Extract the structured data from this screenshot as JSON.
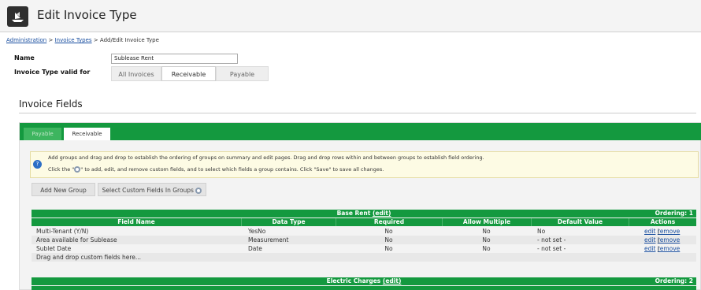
{
  "header": {
    "title": "Edit Invoice Type",
    "app_icon": "ship-icon"
  },
  "breadcrumb": {
    "items": [
      "Administration",
      "Invoice Types"
    ],
    "separator": ">",
    "current": "Add/Edit Invoice Type"
  },
  "form": {
    "name_label": "Name",
    "name_value": "Sublease Rent",
    "valid_for_label": "Invoice Type valid for",
    "valid_for_options": [
      "All Invoices",
      "Receivable",
      "Payable"
    ],
    "valid_for_selected": "Receivable"
  },
  "invoice_fields": {
    "section_title": "Invoice Fields",
    "tabs": [
      {
        "label": "Payable",
        "active": false
      },
      {
        "label": "Receivable",
        "active": true
      }
    ],
    "info_line1": "Add groups and drag and drop to establish the ordering of groups on summary and edit pages. Drag and drop rows within and between groups to establish field ordering.",
    "info_line2_prefix": "Click the \"",
    "info_line2_suffix": "\" to add, edit, and remove custom fields, and to select which fields a group contains. Click \"Save\" to save all changes.",
    "add_group_button": "Add New Group",
    "select_fields_button": "Select Custom Fields In Groups",
    "columns": [
      "Field Name",
      "Data Type",
      "Required",
      "Allow Multiple",
      "Default Value",
      "Actions"
    ],
    "groups": [
      {
        "name": "Base Rent",
        "edit_label": "(edit)",
        "ordering": "Ordering: 1",
        "rows": [
          {
            "field": "Multi-Tenant (Y/N)",
            "type": "YesNo",
            "required": "No",
            "multiple": "No",
            "default": "No",
            "edit": "edit",
            "sep": "|",
            "remove": "remove"
          },
          {
            "field": "Area available for Sublease",
            "type": "Measurement",
            "required": "No",
            "multiple": "No",
            "default": "- not set -",
            "edit": "edit",
            "sep": "|",
            "remove": "remove"
          },
          {
            "field": "Sublet Date",
            "type": "Date",
            "required": "No",
            "multiple": "No",
            "default": "- not set -",
            "edit": "edit",
            "sep": "|",
            "remove": "remove"
          }
        ],
        "drop_hint": "Drag and drop custom fields here..."
      },
      {
        "name": "Electric Charges",
        "edit_label": "(edit)",
        "ordering": "Ordering: 2"
      }
    ]
  },
  "colors": {
    "accent_green": "#14993f",
    "link_blue": "#1a4fa0",
    "info_bg": "#fdfbe4"
  }
}
